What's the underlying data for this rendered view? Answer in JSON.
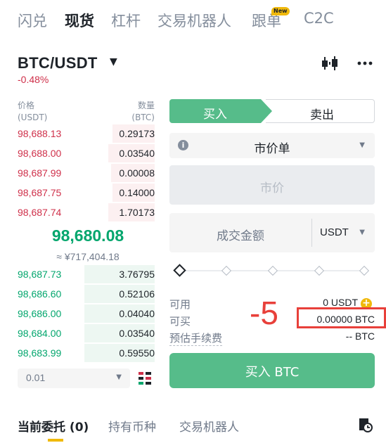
{
  "top_tabs": [
    {
      "label": "闪兑",
      "active": false
    },
    {
      "label": "现货",
      "active": true
    },
    {
      "label": "杠杆",
      "active": false
    },
    {
      "label": "交易机器人",
      "active": false
    },
    {
      "label": "跟单",
      "active": false,
      "badge": "New"
    },
    {
      "label": "C2C",
      "active": false
    }
  ],
  "header": {
    "pair": "BTC/USDT",
    "change": "-0.48%",
    "icons": [
      "candlestick-chart-icon",
      "more-dots-icon"
    ]
  },
  "orderbook": {
    "price_header": "价格",
    "price_unit": "(USDT)",
    "qty_header": "数量",
    "qty_unit": "(BTC)",
    "asks": [
      {
        "price": "98,688.13",
        "qty": "0.29173",
        "depth": 0.3
      },
      {
        "price": "98,688.00",
        "qty": "0.03540",
        "depth": 0.33
      },
      {
        "price": "98,687.99",
        "qty": "0.00008",
        "depth": 0.31
      },
      {
        "price": "98,687.75",
        "qty": "0.14000",
        "depth": 0.3
      },
      {
        "price": "98,687.74",
        "qty": "1.70173",
        "depth": 0.33
      }
    ],
    "last_price": "98,680.08",
    "approx": "≈ ¥717,404.18",
    "bids": [
      {
        "price": "98,687.73",
        "qty": "3.76795",
        "depth": 0.5
      },
      {
        "price": "98,686.60",
        "qty": "0.52106",
        "depth": 0.5
      },
      {
        "price": "98,686.00",
        "qty": "0.04040",
        "depth": 0.5
      },
      {
        "price": "98,684.00",
        "qty": "0.03540",
        "depth": 0.5
      },
      {
        "price": "98,683.99",
        "qty": "0.59550",
        "depth": 0.5
      }
    ],
    "depth_value": "0.01"
  },
  "order_form": {
    "buy_label": "买入",
    "sell_label": "卖出",
    "order_type": "市价单",
    "market_placeholder": "市价",
    "amount_placeholder": "成交金额",
    "amount_unit": "USDT",
    "slider_value": 0,
    "available_label": "可用",
    "available_value": "0 USDT",
    "can_buy_label": "可买",
    "can_buy_value": "0.00000 BTC",
    "fee_label": "预估手续费",
    "fee_value": "-- BTC",
    "submit_label": "买入 BTC"
  },
  "annotation": {
    "text": "-5",
    "color": "#e8403a"
  },
  "bottom_tabs": [
    {
      "label": "当前委托 (0)",
      "active": true
    },
    {
      "label": "持有币种",
      "active": false
    },
    {
      "label": "交易机器人",
      "active": false
    }
  ],
  "colors": {
    "buy": "#56bc8a",
    "ask": "#cf304a",
    "bid": "#03a66d",
    "accent": "#f0b90b"
  }
}
